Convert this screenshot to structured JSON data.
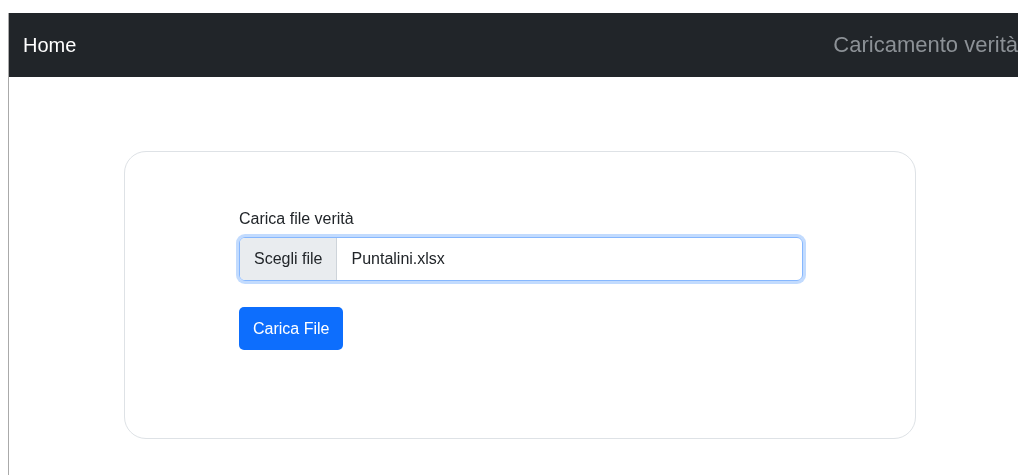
{
  "navbar": {
    "home_link": "Home",
    "page_title": "Caricamento verità"
  },
  "form": {
    "label": "Carica file verità",
    "file_field": {
      "button": "Scegli file",
      "value": "Puntalini.xlsx",
      "focused": true
    },
    "submit_button": "Carica File"
  }
}
